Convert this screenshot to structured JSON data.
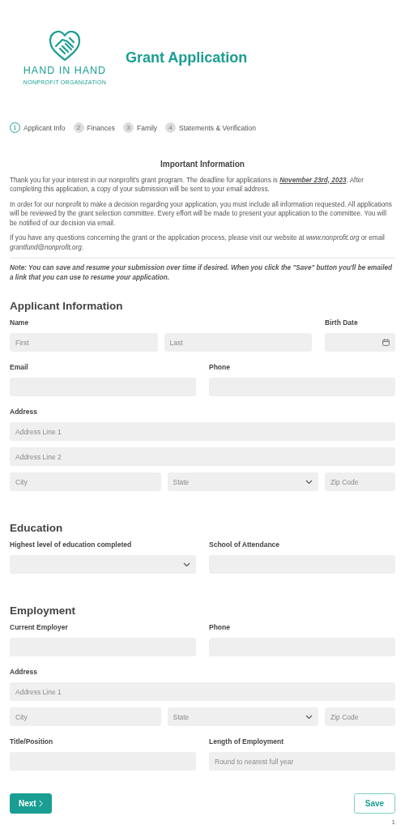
{
  "logo": {
    "name": "HAND IN HAND",
    "tagline": "NONPROFIT ORGANIZATION"
  },
  "title": "Grant Application",
  "steps": [
    {
      "number": "1",
      "label": "Applicant Info",
      "selected": true
    },
    {
      "number": "2",
      "label": "Finances",
      "selected": false
    },
    {
      "number": "3",
      "label": "Family",
      "selected": false
    },
    {
      "number": "4",
      "label": "Statements & Verification",
      "selected": false
    }
  ],
  "info": {
    "heading": "Important Information",
    "paragraphs": [
      "Thank you for your interest in our nonprofit's grant program. The deadline for applications is **November 23rd, 2023**. After completing this application, a copy of your submission will be sent to your email address.",
      "In order for our nonprofit to make a decision regarding your application, you must include all information requested. All applications will be reviewed by the grant selection committee. Every effort will be made to present your application to the committee. You will be notified of our decision via email.",
      "If you have any questions concerning the grant or the application process, please visit our website at *www.nonprofit.org* or email *grantfund@nonprofit.org*."
    ],
    "note": "Note: You can save and resume your submission over time if desired. When you click the \"Save\" button you'll be emailed a link that you can use to resume your application."
  },
  "sections": [
    {
      "heading": "Applicant Information",
      "rows": [
        {
          "groups": [
            {
              "label": "Name",
              "fields": [
                {
                  "kind": "text",
                  "placeholder": "First"
                },
                {
                  "kind": "text",
                  "placeholder": "Last"
                }
              ]
            },
            {
              "label": "Birth Date",
              "fields": [
                {
                  "kind": "date"
                }
              ]
            }
          ]
        },
        {
          "groups": [
            {
              "label": "Email",
              "fields": [
                {
                  "kind": "text"
                }
              ]
            },
            {
              "label": "Phone",
              "fields": [
                {
                  "kind": "text"
                }
              ]
            }
          ]
        },
        {
          "groups": [
            {
              "label": "Address",
              "fields": [
                {
                  "kind": "text",
                  "placeholder": "Address Line 1"
                }
              ]
            }
          ]
        },
        {
          "groups": [
            {
              "fields": [
                {
                  "kind": "text",
                  "placeholder": "Address Line 2"
                }
              ]
            }
          ]
        },
        {
          "groups": [
            {
              "fields": [
                {
                  "kind": "text",
                  "placeholder": "City"
                },
                {
                  "kind": "select",
                  "placeholder": "State"
                },
                {
                  "kind": "text",
                  "placeholder": "Zip Code"
                }
              ]
            }
          ]
        }
      ]
    },
    {
      "heading": "Education",
      "rows": [
        {
          "groups": [
            {
              "label": "Highest level of education completed",
              "fields": [
                {
                  "kind": "select"
                }
              ]
            },
            {
              "label": "School of Attendance",
              "fields": [
                {
                  "kind": "text"
                }
              ]
            }
          ]
        }
      ]
    },
    {
      "heading": "Employment",
      "rows": [
        {
          "groups": [
            {
              "label": "Current Employer",
              "fields": [
                {
                  "kind": "text"
                }
              ]
            },
            {
              "label": "Phone",
              "fields": [
                {
                  "kind": "text"
                }
              ]
            }
          ]
        },
        {
          "groups": [
            {
              "label": "Address",
              "fields": [
                {
                  "kind": "text",
                  "placeholder": "Address Line 1"
                }
              ]
            }
          ]
        },
        {
          "groups": [
            {
              "fields": [
                {
                  "kind": "text",
                  "placeholder": "City"
                },
                {
                  "kind": "select",
                  "placeholder": "State"
                },
                {
                  "kind": "text",
                  "placeholder": "Zip Code"
                }
              ]
            }
          ]
        },
        {
          "groups": [
            {
              "label": "Title/Position",
              "fields": [
                {
                  "kind": "text"
                }
              ]
            },
            {
              "label": "Length of Employment",
              "fields": [
                {
                  "kind": "text",
                  "placeholder": "Round to nearest full year"
                }
              ]
            }
          ]
        }
      ]
    }
  ],
  "actions": {
    "next": "Next",
    "save": "Save",
    "page_number": "1"
  }
}
